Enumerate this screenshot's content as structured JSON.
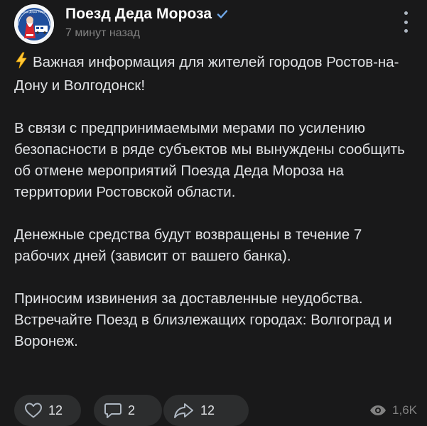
{
  "post": {
    "author": "Поезд Деда Мороза",
    "time_ago": "7 минут назад",
    "avatar_caption": "Поезд Деда Мороза",
    "paragraphs": [
      "Важная информация для жителей городов Ростов-на-Дону и Волгодонск!",
      "В связи с предпринимаемыми мерами по усилению безопасности в ряде субъектов мы вынуждены сообщить об отмене мероприятий Поезда Деда Мороза на территории Ростовской области.",
      "Денежные средства будут возвращены в течение 7 рабочих дней (зависит от вашего банка).",
      "Приносим извинения за доставленные неудобства. Встречайте Поезд в близлежащих городах: Волгоград и Воронеж."
    ]
  },
  "actions": {
    "likes": "12",
    "comments": "2",
    "shares": "12",
    "views": "1,6K"
  },
  "icons": {
    "verified": "verified-check-icon",
    "more": "more-vertical-icon",
    "lightning": "lightning-emoji-icon",
    "like": "heart-icon",
    "comment": "comment-bubble-icon",
    "share": "share-arrow-icon",
    "views": "eye-icon"
  },
  "colors": {
    "background": "#19191a",
    "text": "#e1e3e6",
    "secondary": "#828282",
    "pill": "#2c2d2e",
    "verified": "#71aaeb"
  }
}
